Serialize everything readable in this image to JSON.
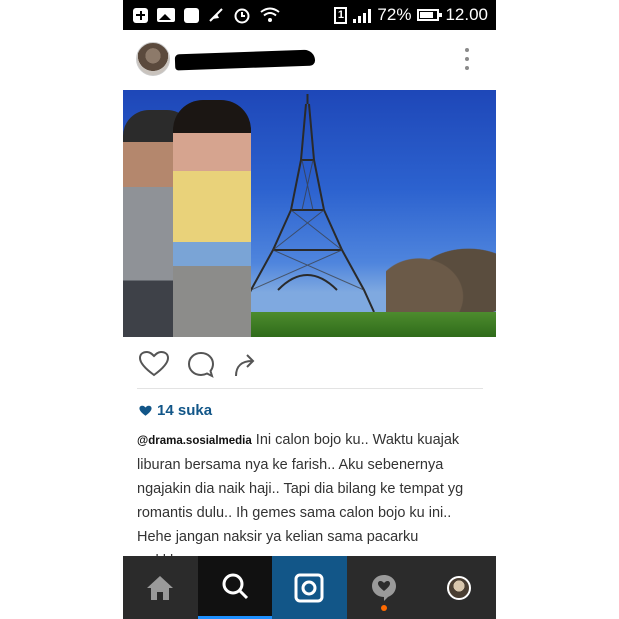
{
  "status_bar": {
    "battery_percent": "72%",
    "time": "12.00",
    "sim_slot": "1",
    "icons": [
      "plus-box-icon",
      "image-icon",
      "bbm-icon",
      "mute-icon",
      "alarm-icon",
      "wifi-icon",
      "sim-icon",
      "signal-icon",
      "battery-icon"
    ]
  },
  "post": {
    "username": "",
    "likes": "14 suka",
    "caption_author": "@drama.sosialmedia",
    "caption_text": " Ini calon bojo ku.. Waktu kuajak liburan bersama nya ke farish.. Aku sebenernya ngajakin dia naik haji.. Tapi dia bilang ke tempat yg romantis dulu.. Ih gemes sama calon bojo ku ini.. Hehe jangan naksir ya kelian sama pacarku wekkkeee.."
  },
  "bottom_nav": {
    "items": [
      "home-icon",
      "search-icon",
      "camera-icon",
      "activity-icon",
      "profile-avatar"
    ],
    "active": "search",
    "accent": "#1e90ff",
    "camera_bg": "#125688",
    "notification_dot": "#ff6a00"
  },
  "colors": {
    "like_blue": "#125688",
    "status_bar": "#000000",
    "nav_bar": "#2b2b2b"
  }
}
